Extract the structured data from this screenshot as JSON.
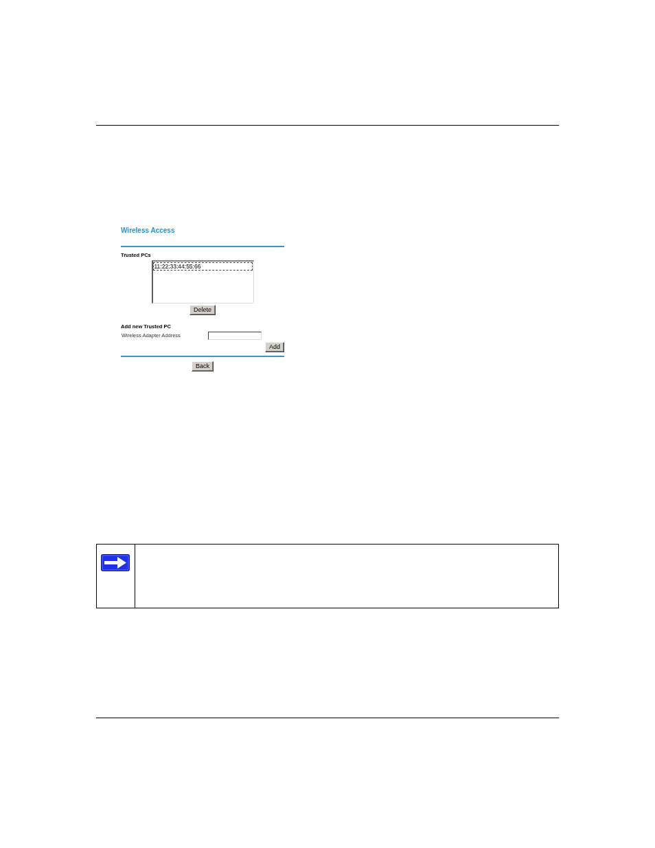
{
  "form": {
    "title": "Wireless Access",
    "trusted_pcs": {
      "label": "Trusted PCs",
      "entries": [
        {
          "text": "11:22:33:44:55:66",
          "focused": true
        }
      ],
      "delete_button": "Delete"
    },
    "add_new": {
      "heading": "Add new Trusted PC",
      "address_field": {
        "label": "Wireless Adapter Address"
      },
      "add_button": "Add"
    },
    "back_button": "Back"
  }
}
